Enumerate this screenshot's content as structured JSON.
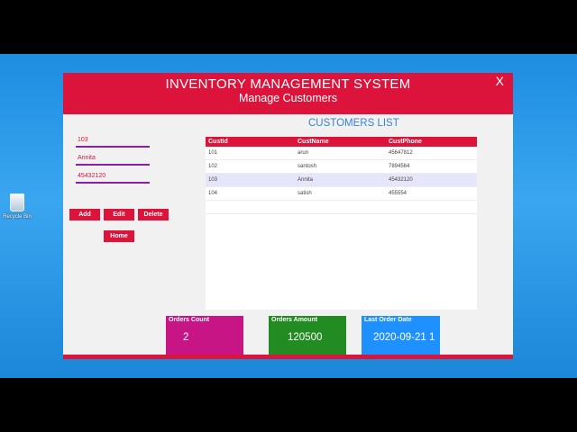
{
  "desktop": {
    "recycle_label": "Recycle Bin"
  },
  "header": {
    "title": "INVENTORY MANAGEMENT SYSTEM",
    "subtitle": "Manage Customers",
    "close": "X"
  },
  "form": {
    "id_value": "103",
    "name_value": "Annita",
    "phone_value": "45432120"
  },
  "buttons": {
    "add": "Add",
    "edit": "Edit",
    "delete": "Delete",
    "home": "Home"
  },
  "list": {
    "title": "CUSTOMERS LIST",
    "columns": [
      "CustId",
      "CustName",
      "CustPhone"
    ],
    "rows": [
      [
        "101",
        "arun",
        "45647812"
      ],
      [
        "102",
        "santosh",
        "7894564"
      ],
      [
        "103",
        "Annita",
        "45432120"
      ],
      [
        "104",
        "satish",
        "455554"
      ]
    ]
  },
  "stats": {
    "orders_count_label": "Orders Count",
    "orders_count_value": "2",
    "orders_amount_label": "Orders Amount",
    "orders_amount_value": "120500",
    "last_order_label": "Last Order Date",
    "last_order_value": "2020-09-21 1"
  },
  "colors": {
    "accent": "#dc143c",
    "count_tile": "#c71585",
    "amount_tile": "#228b22",
    "date_tile": "#1e90ff"
  }
}
